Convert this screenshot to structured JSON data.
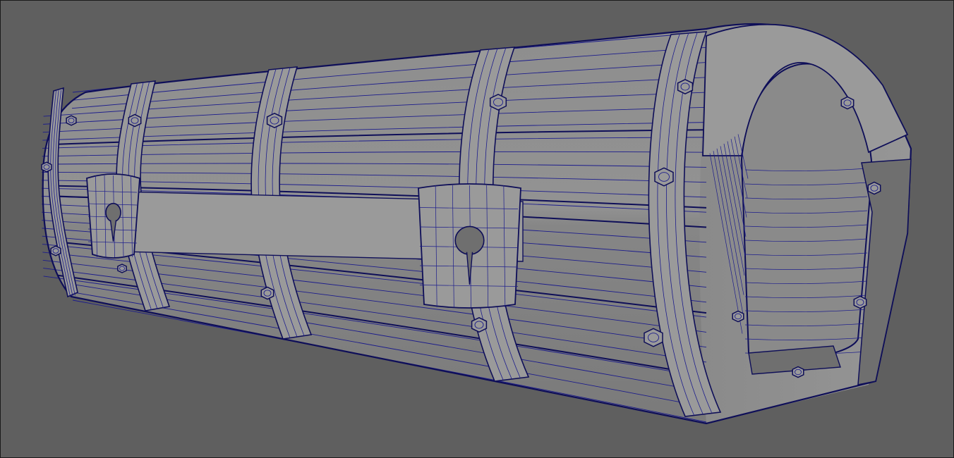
{
  "viewport": {
    "background_color": "#5f5f5f",
    "shaded_surface_color": "#8a8a8a",
    "surface_highlight_color": "#9a9a9a",
    "surface_shadow_color": "#6f6f6f",
    "wireframe_color": "#1c1c8c",
    "edge_outline_color": "#0e0e58",
    "display_mode": "wireframe-on-shaded"
  },
  "model": {
    "object": "treasure-chest",
    "parts": [
      "body-cylinder",
      "end-cap-arch",
      "straps",
      "lock-plates",
      "rivets"
    ]
  }
}
